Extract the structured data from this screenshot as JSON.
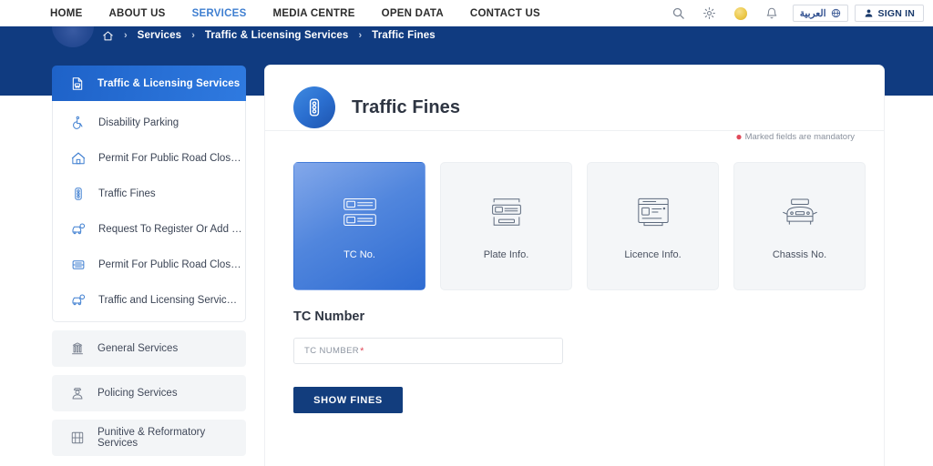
{
  "topnav": {
    "links": [
      {
        "label": "HOME",
        "active": false
      },
      {
        "label": "ABOUT US",
        "active": false
      },
      {
        "label": "SERVICES",
        "active": true
      },
      {
        "label": "MEDIA CENTRE",
        "active": false
      },
      {
        "label": "OPEN DATA",
        "active": false
      },
      {
        "label": "CONTACT US",
        "active": false
      }
    ],
    "search_icon": "search-icon",
    "settings_icon": "gear-icon",
    "accessibility_icon": "gold-circle-icon",
    "notifications_icon": "bell-icon",
    "language_label": "العربية",
    "language_icon": "globe-icon",
    "signin_label": "SIGN IN",
    "signin_icon": "user-icon"
  },
  "breadcrumb": {
    "home_icon": "home-icon",
    "separator": "›",
    "items": [
      {
        "label": "Services"
      },
      {
        "label": "Traffic & Licensing Services"
      },
      {
        "label": "Traffic Fines"
      }
    ]
  },
  "sidebar": {
    "active": {
      "label": "Traffic & Licensing Services",
      "icon": "document-vehicle-icon"
    },
    "items": [
      {
        "label": "Disability Parking",
        "icon": "wheelchair-icon"
      },
      {
        "label": "Permit For Public Road Closing",
        "icon": "tent-icon"
      },
      {
        "label": "Traffic Fines",
        "icon": "traffic-light-icon"
      },
      {
        "label": "Request To Register Or Add Ve...",
        "icon": "vehicle-register-icon"
      },
      {
        "label": "Permit For Public Road Closing ...",
        "icon": "road-closing-icon"
      },
      {
        "label": "Traffic and Licensing Services P...",
        "icon": "vehicle-register-icon"
      }
    ],
    "groups": [
      {
        "label": "General Services",
        "icon": "building-icon"
      },
      {
        "label": "Policing Services",
        "icon": "officer-icon"
      },
      {
        "label": "Punitive & Reformatory Services",
        "icon": "jail-icon"
      }
    ]
  },
  "main": {
    "title": "Traffic Fines",
    "title_icon": "traffic-light-icon",
    "mandatory_note": "Marked fields are mandatory",
    "mandatory_marker": "●",
    "tabs": [
      {
        "label": "TC No.",
        "icon": "double-plate-icon",
        "selected": true
      },
      {
        "label": "Plate Info.",
        "icon": "plate-info-icon",
        "selected": false
      },
      {
        "label": "Licence Info.",
        "icon": "licence-card-icon",
        "selected": false
      },
      {
        "label": "Chassis No.",
        "icon": "car-front-icon",
        "selected": false
      }
    ],
    "form": {
      "label": "TC Number",
      "input_placeholder": "TC NUMBER",
      "input_value": "",
      "required_marker": "*",
      "submit_label": "SHOW FINES"
    }
  },
  "colors": {
    "banner_blue": "#103b80",
    "accent_blue": "#2f7ae0",
    "button_blue": "#123d7d",
    "nav_active": "#3f7fd1",
    "required_red": "#e04a5a",
    "gold": "#ecc94b"
  }
}
